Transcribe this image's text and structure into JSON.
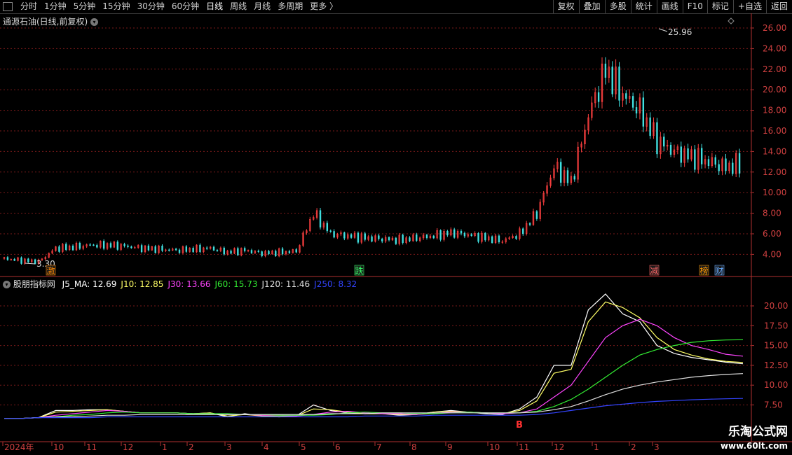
{
  "toolbar": {
    "periods": [
      "分时",
      "1分钟",
      "5分钟",
      "15分钟",
      "30分钟",
      "60分钟",
      "日线",
      "周线",
      "月线",
      "多周期",
      "更多 〉"
    ],
    "active_period": "日线",
    "right_buttons": [
      "复权",
      "叠加",
      "多股",
      "统计",
      "画线",
      "F10",
      "标记",
      "+自选",
      "返回"
    ]
  },
  "price_chart": {
    "title": "通源石油(日线,前复权)",
    "high_label": "25.96",
    "low_label": "3.30",
    "y_ticks": [
      "26.00",
      "24.00",
      "22.00",
      "20.00",
      "18.00",
      "16.00",
      "14.00",
      "12.00",
      "10.00",
      "8.00",
      "6.00",
      "4.00"
    ],
    "markers": [
      {
        "text": "激",
        "color": "#ff8800"
      },
      {
        "text": "跌",
        "color": "#33ff66"
      },
      {
        "text": "减",
        "color": "#ff6666"
      },
      {
        "text": "榜",
        "color": "#ff9900"
      },
      {
        "text": "财",
        "color": "#66aaff"
      }
    ]
  },
  "indicator_chart": {
    "name": "股朋指标网",
    "items": [
      {
        "label": "J5_MA: 12.69",
        "color": "#ffffff"
      },
      {
        "label": "J10: 12.85",
        "color": "#ffff66"
      },
      {
        "label": "J30: 13.66",
        "color": "#ff44ff"
      },
      {
        "label": "J60: 15.73",
        "color": "#33ee33"
      },
      {
        "label": "J120: 11.46",
        "color": "#e0e0e0"
      },
      {
        "label": "J250: 8.32",
        "color": "#3344ff"
      }
    ],
    "y_ticks": [
      "20.00",
      "17.50",
      "15.00",
      "12.50",
      "10.00",
      "7.50"
    ],
    "signal_label": "B"
  },
  "x_axis": {
    "labels": [
      "2024年",
      "10",
      "11",
      "12",
      "1",
      "2",
      "3",
      "4",
      "5",
      "6",
      "7",
      "8",
      "9",
      "10",
      "11",
      "12",
      "1",
      "2",
      "3"
    ]
  },
  "logo": {
    "line1": "乐淘公式网",
    "line2": "www.60lt.com"
  },
  "chart_data": [
    {
      "type": "candlestick",
      "title": "通源石油(日线,前复权)",
      "ylim": [
        3,
        27
      ],
      "annotations": {
        "high": 25.96,
        "low": 3.3
      },
      "x_months": [
        "2024年",
        "10",
        "11",
        "12",
        "1",
        "2",
        "3",
        "4",
        "5",
        "6",
        "7",
        "8",
        "9",
        "10",
        "11",
        "12",
        "1",
        "2",
        "3"
      ],
      "series": [
        {
          "name": "close",
          "x_index": [
            0,
            10,
            20,
            30,
            40,
            50,
            60,
            70,
            80,
            90,
            100,
            110,
            120,
            130,
            140,
            150,
            160,
            170,
            180,
            190,
            200,
            210,
            220,
            230,
            240,
            250,
            260,
            270,
            280,
            290,
            300,
            310,
            320,
            330,
            340,
            350,
            360,
            370,
            380,
            390,
            400,
            410,
            420,
            430
          ],
          "values": [
            3.6,
            3.4,
            3.3,
            4.6,
            4.7,
            4.9,
            4.9,
            4.8,
            4.6,
            4.5,
            4.4,
            4.5,
            4.6,
            4.2,
            4.4,
            4.1,
            4.2,
            4.3,
            8.0,
            6.0,
            5.8,
            5.6,
            5.5,
            5.4,
            5.6,
            5.8,
            6.1,
            5.9,
            5.6,
            5.3,
            6.0,
            8.0,
            12.5,
            11.0,
            17.5,
            22.0,
            19.5,
            18.0,
            15.0,
            14.0,
            13.5,
            13.0,
            12.5,
            12.8
          ]
        }
      ]
    },
    {
      "type": "line",
      "ylim": [
        5,
        23
      ],
      "x_index": [
        0,
        10,
        20,
        30,
        40,
        50,
        60,
        70,
        80,
        90,
        100,
        110,
        120,
        130,
        140,
        150,
        160,
        170,
        180,
        190,
        200,
        210,
        220,
        230,
        240,
        250,
        260,
        270,
        280,
        290,
        300,
        310,
        320,
        330,
        340,
        350,
        360,
        370,
        380,
        390,
        400,
        410,
        420,
        430
      ],
      "series": [
        {
          "name": "J5_MA",
          "values": [
            5.8,
            5.8,
            5.9,
            6.8,
            6.8,
            6.9,
            6.9,
            6.7,
            6.5,
            6.5,
            6.5,
            6.4,
            6.5,
            6.0,
            6.4,
            6.1,
            6.0,
            6.1,
            7.5,
            6.8,
            6.5,
            6.4,
            6.4,
            6.2,
            6.3,
            6.6,
            6.8,
            6.6,
            6.4,
            6.3,
            7.0,
            8.5,
            12.5,
            12.5,
            19.5,
            21.5,
            19.0,
            18.0,
            15.0,
            14.0,
            13.5,
            13.2,
            12.9,
            12.69
          ]
        },
        {
          "name": "J10",
          "values": [
            5.8,
            5.8,
            5.9,
            6.6,
            6.7,
            6.8,
            6.9,
            6.7,
            6.5,
            6.5,
            6.5,
            6.4,
            6.5,
            6.1,
            6.3,
            6.1,
            6.1,
            6.1,
            7.0,
            6.9,
            6.6,
            6.4,
            6.4,
            6.3,
            6.3,
            6.6,
            6.7,
            6.6,
            6.5,
            6.4,
            6.8,
            8.0,
            11.5,
            12.0,
            18.0,
            20.5,
            19.8,
            18.5,
            16.0,
            14.5,
            13.8,
            13.3,
            13.0,
            12.85
          ]
        },
        {
          "name": "J30",
          "values": [
            5.8,
            5.8,
            5.9,
            6.2,
            6.4,
            6.6,
            6.8,
            6.7,
            6.5,
            6.5,
            6.5,
            6.4,
            6.4,
            6.3,
            6.3,
            6.2,
            6.2,
            6.1,
            6.3,
            6.6,
            6.7,
            6.5,
            6.4,
            6.4,
            6.3,
            6.4,
            6.6,
            6.6,
            6.5,
            6.4,
            6.5,
            7.0,
            8.5,
            10.0,
            13.0,
            16.0,
            17.5,
            18.3,
            17.5,
            16.0,
            15.0,
            14.5,
            13.9,
            13.66
          ]
        },
        {
          "name": "J60",
          "values": [
            5.8,
            5.8,
            5.9,
            6.0,
            6.2,
            6.3,
            6.5,
            6.6,
            6.5,
            6.5,
            6.5,
            6.4,
            6.4,
            6.4,
            6.3,
            6.3,
            6.2,
            6.2,
            6.2,
            6.3,
            6.5,
            6.6,
            6.5,
            6.5,
            6.4,
            6.4,
            6.5,
            6.6,
            6.5,
            6.5,
            6.5,
            6.7,
            7.3,
            8.2,
            9.5,
            11.0,
            12.5,
            13.8,
            14.5,
            15.0,
            15.4,
            15.6,
            15.7,
            15.73
          ]
        },
        {
          "name": "J120",
          "values": [
            5.8,
            5.8,
            5.9,
            6.0,
            6.0,
            6.1,
            6.2,
            6.2,
            6.3,
            6.3,
            6.3,
            6.3,
            6.3,
            6.3,
            6.3,
            6.3,
            6.3,
            6.3,
            6.3,
            6.4,
            6.4,
            6.4,
            6.5,
            6.5,
            6.5,
            6.5,
            6.5,
            6.5,
            6.5,
            6.5,
            6.5,
            6.6,
            6.9,
            7.3,
            8.0,
            8.8,
            9.5,
            10.0,
            10.4,
            10.7,
            11.0,
            11.2,
            11.35,
            11.46
          ]
        },
        {
          "name": "J250",
          "values": [
            5.8,
            5.8,
            5.9,
            5.9,
            5.9,
            5.9,
            6.0,
            6.0,
            6.0,
            6.0,
            6.0,
            6.0,
            6.0,
            6.0,
            6.0,
            6.0,
            6.0,
            6.0,
            6.0,
            6.0,
            6.0,
            6.1,
            6.1,
            6.1,
            6.1,
            6.2,
            6.2,
            6.2,
            6.2,
            6.2,
            6.2,
            6.3,
            6.5,
            6.8,
            7.1,
            7.4,
            7.6,
            7.8,
            7.95,
            8.05,
            8.15,
            8.22,
            8.28,
            8.32
          ]
        }
      ]
    }
  ]
}
